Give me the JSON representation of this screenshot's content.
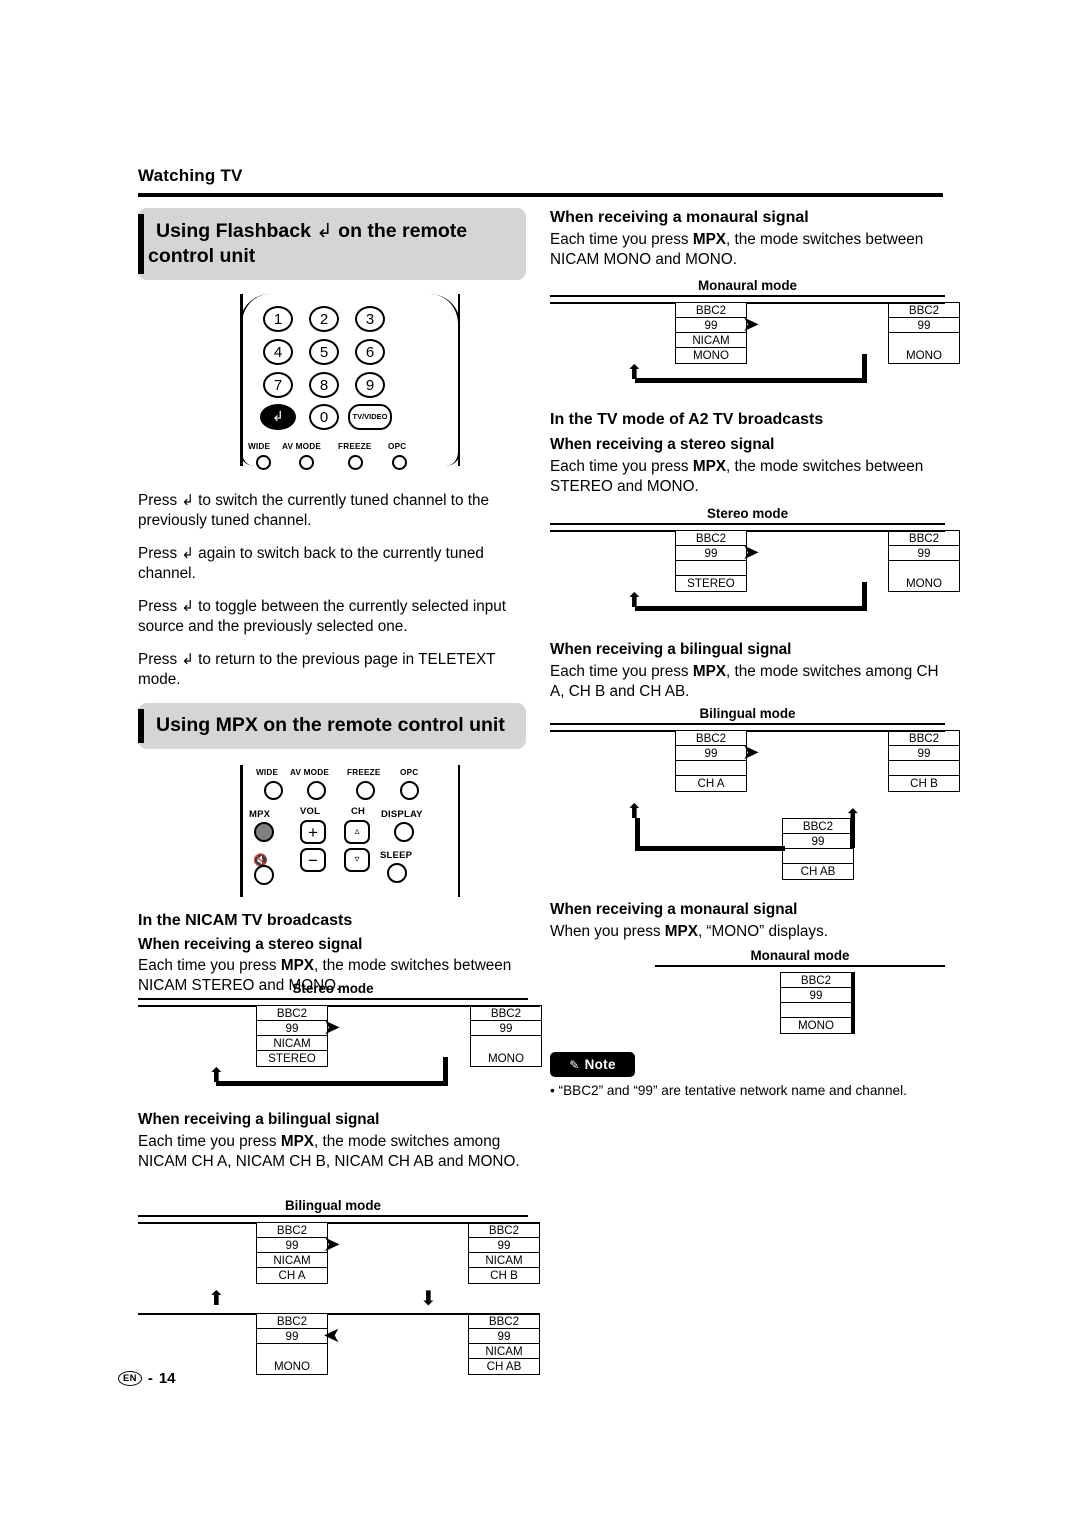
{
  "page": {
    "header": "Watching TV",
    "footer_locale": "EN",
    "footer_page": "14"
  },
  "left": {
    "section1_title_pre": "Using Flashback (",
    "section1_title_glyph": "↶",
    "section1_title_post": ") on the remote control unit",
    "section1_title_full": "Using Flashback ⮐ on the remote control unit",
    "remote1": {
      "keys": [
        "1",
        "2",
        "3",
        "4",
        "5",
        "6",
        "7",
        "8",
        "9",
        "↶",
        "0",
        "TV/VIDEO"
      ],
      "labels": [
        "WIDE",
        "AV MODE",
        "FREEZE",
        "OPC"
      ]
    },
    "para1": "Press ⮐ to switch the currently tuned channel to the previously tuned channel.",
    "para2": "Press ⮐ again to switch back to the currently tuned channel.",
    "para3": "Press ⮐ to toggle between the currently selected input source and the previously selected one.",
    "para4": "Press ⮐ to return to the previous page in TELETEXT mode.",
    "section2_title": "Using MPX on the remote control unit",
    "remote2": {
      "top_labels": [
        "WIDE",
        "AV MODE",
        "FREEZE",
        "OPC"
      ],
      "row_labels": [
        "MPX",
        "VOL",
        "CH",
        "DISPLAY"
      ],
      "sleep_label": "SLEEP",
      "mute_icon": "mute-icon"
    },
    "heading_nicam": "In the NICAM TV broadcasts",
    "sub_stereo": "When receiving a stereo signal",
    "text_stereo": "Each time you press MPX, the mode switches between NICAM STEREO and MONO.",
    "text_stereo_bold": "MPX",
    "diagram_stereo": {
      "title": "Stereo mode",
      "boxes": [
        {
          "lines": [
            "BBC2",
            "99",
            "NICAM",
            "STEREO"
          ]
        },
        {
          "lines": [
            "BBC2",
            "99",
            "",
            "MONO"
          ]
        }
      ]
    },
    "sub_bilingual": "When receiving a bilingual signal",
    "text_bilingual": "Each time you press MPX, the mode switches among NICAM CH A, NICAM CH B, NICAM CH AB and MONO.",
    "diagram_bilingual": {
      "title": "Bilingual mode",
      "boxes": [
        {
          "lines": [
            "BBC2",
            "99",
            "NICAM",
            "CH A"
          ]
        },
        {
          "lines": [
            "BBC2",
            "99",
            "NICAM",
            "CH B"
          ]
        },
        {
          "lines": [
            "BBC2",
            "99",
            "",
            "MONO"
          ]
        },
        {
          "lines": [
            "BBC2",
            "99",
            "NICAM",
            "CH AB"
          ]
        }
      ]
    }
  },
  "right": {
    "sub_monaural_1": "When receiving a monaural signal",
    "text_monaural_1": "Each time you press MPX, the mode switches between NICAM MONO and MONO.",
    "diagram_monaural_1": {
      "title": "Monaural mode",
      "boxes": [
        {
          "lines": [
            "BBC2",
            "99",
            "NICAM",
            "MONO"
          ]
        },
        {
          "lines": [
            "BBC2",
            "99",
            "",
            "MONO"
          ]
        }
      ]
    },
    "heading_a2": "In the TV mode of A2 TV broadcasts",
    "sub_stereo": "When receiving a stereo signal",
    "text_stereo": "Each time you press MPX, the mode switches between STEREO and MONO.",
    "diagram_stereo": {
      "title": "Stereo mode",
      "boxes": [
        {
          "lines": [
            "BBC2",
            "99",
            "STEREO"
          ]
        },
        {
          "lines": [
            "BBC2",
            "99",
            "MONO"
          ]
        }
      ]
    },
    "sub_bilingual": "When receiving a bilingual signal",
    "text_bilingual": "Each time you press MPX, the mode switches among CH A, CH B and CH AB.",
    "diagram_bilingual": {
      "title": "Bilingual mode",
      "boxes": [
        {
          "lines": [
            "BBC2",
            "99",
            "CH A"
          ]
        },
        {
          "lines": [
            "BBC2",
            "99",
            "CH B"
          ]
        },
        {
          "lines": [
            "BBC2",
            "99",
            "CH AB"
          ]
        }
      ]
    },
    "sub_monaural_2": "When receiving a monaural signal",
    "text_monaural_2": "When you press MPX, “MONO” displays.",
    "diagram_monaural_2": {
      "title": "Monaural mode",
      "boxes": [
        {
          "lines": [
            "BBC2",
            "99",
            "MONO"
          ]
        }
      ]
    },
    "note_label": "Note",
    "note_text": "•  “BBC2” and “99” are tentative network name and channel."
  }
}
